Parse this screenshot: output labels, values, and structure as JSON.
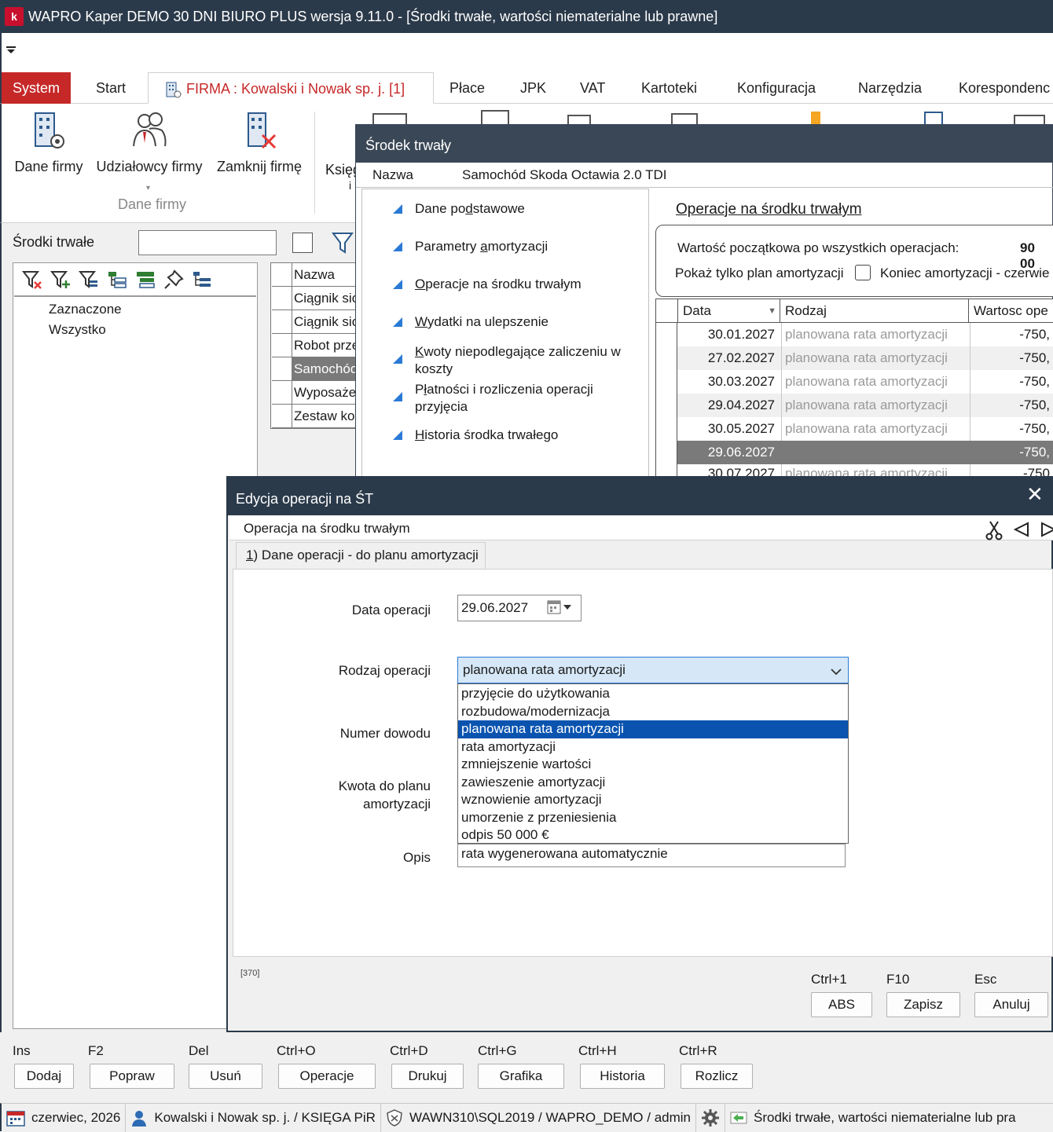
{
  "window": {
    "title": "WAPRO Kaper DEMO 30 DNI BIURO PLUS wersja 9.11.0 - [Środki trwałe, wartości niematerialne lub prawne]",
    "logo_letter": "k"
  },
  "menu": {
    "system": "System",
    "start": "Start",
    "firma": "FIRMA : Kowalski i Nowak sp. j. [1]",
    "place": "Płace",
    "jpk": "JPK",
    "vat": "VAT",
    "kartoteki": "Kartoteki",
    "konfiguracja": "Konfiguracja",
    "narzedzia": "Narzędzia",
    "korespondencja": "Korespondenc"
  },
  "ribbon": {
    "dane_firmy": "Dane firmy",
    "udzialowcy": "Udziałowcy firmy",
    "zamknij": "Zamknij firmę",
    "ksieg": "Księg",
    "ksieg2": "i",
    "group_label": "Dane firmy"
  },
  "left": {
    "srodki_label": "Środki trwałe",
    "tree": [
      "Zaznaczone",
      "Wszystko"
    ],
    "grid_header": "Nazwa",
    "grid_rows": [
      "Ciągnik sio",
      "Ciągnik sio",
      "Robot prze",
      "Samochód",
      "Wyposaże",
      "Zestaw ko"
    ]
  },
  "st": {
    "title": "Środek trwały",
    "nazwa_label": "Nazwa",
    "nazwa_value": "Samochód Skoda Octawia 2.0 TDI",
    "nav": [
      {
        "pre": "Dane po",
        "ul": "d",
        "post": "stawowe"
      },
      {
        "pre": "Parametry ",
        "ul": "a",
        "post": "mortyzacji"
      },
      {
        "pre": "",
        "ul": "O",
        "post": "peracje na środku trwałym"
      },
      {
        "pre": "",
        "ul": "W",
        "post": "ydatki na ulepszenie"
      },
      {
        "pre": "",
        "ul": "K",
        "post": "woty niepodlegające zaliczeniu w"
      },
      {
        "pre": "P",
        "ul": "ł",
        "post": "atności i rozliczenia operacji"
      },
      {
        "pre": "",
        "ul": "H",
        "post": "istoria środka trwałego"
      }
    ],
    "nav_line2": [
      "koszty",
      "przyjęcia"
    ],
    "ops_title": "Operacje na środku trwałym",
    "wp_label": "Wartość początkowa po wszystkich operacjach:",
    "wp_value": "90 00",
    "plan_label": "Pokaż tylko plan amortyzacji",
    "koniec_label": "Koniec amortyzacji - czerwie",
    "cols": [
      "Data",
      "Rodzaj",
      "Wartosc ope"
    ],
    "rows": [
      {
        "date": "30.01.2027",
        "type": "planowana rata amortyzacji",
        "value": "-750,"
      },
      {
        "date": "27.02.2027",
        "type": "planowana rata amortyzacji",
        "value": "-750,"
      },
      {
        "date": "30.03.2027",
        "type": "planowana rata amortyzacji",
        "value": "-750,"
      },
      {
        "date": "29.04.2027",
        "type": "planowana rata amortyzacji",
        "value": "-750,"
      },
      {
        "date": "30.05.2027",
        "type": "planowana rata amortyzacji",
        "value": "-750,"
      },
      {
        "date": "29.06.2027",
        "type": "",
        "value": "-750,"
      },
      {
        "date": "30.07.2027",
        "type": "planowana rata amortyzacji",
        "value": "-750"
      }
    ]
  },
  "edycja": {
    "title": "Edycja operacji na ŚT",
    "op_label": "Operacja na środku trwałym",
    "tab_num": "1",
    "tab_label": ") Dane operacji - do planu amortyzacji",
    "data_label": "Data operacji",
    "data_value": "29.06.2027",
    "rodzaj_label": "Rodzaj operacji",
    "rodzaj_value": "planowana rata amortyzacji",
    "numer_label": "Numer dowodu",
    "kwota_label1": "Kwota do planu",
    "kwota_label2": "amortyzacji",
    "opis_label": "Opis",
    "opis_value": "rata wygenerowana  automatycznie",
    "options": [
      "przyjęcie do użytkowania",
      "rozbudowa/modernizacja",
      "planowana rata amortyzacji",
      "rata amortyzacji",
      "zmniejszenie wartości",
      "zawieszenie amortyzacji",
      "wznowienie amortyzacji",
      "umorzenie z przeniesienia",
      "odpis 50 000 €"
    ],
    "code": "[370]",
    "buttons": [
      {
        "key": "Ctrl+1",
        "label": "ABS"
      },
      {
        "key": "F10",
        "label": "Zapisz"
      },
      {
        "key": "Esc",
        "label": "Anuluj"
      }
    ]
  },
  "bottom_buttons": [
    {
      "key": "Ins",
      "label": "Dodaj"
    },
    {
      "key": "F2",
      "label": "Popraw"
    },
    {
      "key": "Del",
      "label": "Usuń"
    },
    {
      "key": "Ctrl+O",
      "label": "Operacje"
    },
    {
      "key": "Ctrl+D",
      "label": "Drukuj"
    },
    {
      "key": "Ctrl+G",
      "label": "Grafika"
    },
    {
      "key": "Ctrl+H",
      "label": "Historia"
    },
    {
      "key": "Ctrl+R",
      "label": "Rozlicz"
    }
  ],
  "status": {
    "date": "czerwiec, 2026",
    "company": "Kowalski i Nowak sp. j. / KSIĘGA PiR",
    "server": "WAWN310\\SQL2019 / WAPRO_DEMO / admin",
    "module": "Środki trwałe, wartości niematerialne lub pra"
  },
  "colors": {
    "accent": "#c62828",
    "titlebar": "#2b3a4a",
    "selection": "#0a54b0",
    "grid_selected": "#7a7a7a"
  }
}
